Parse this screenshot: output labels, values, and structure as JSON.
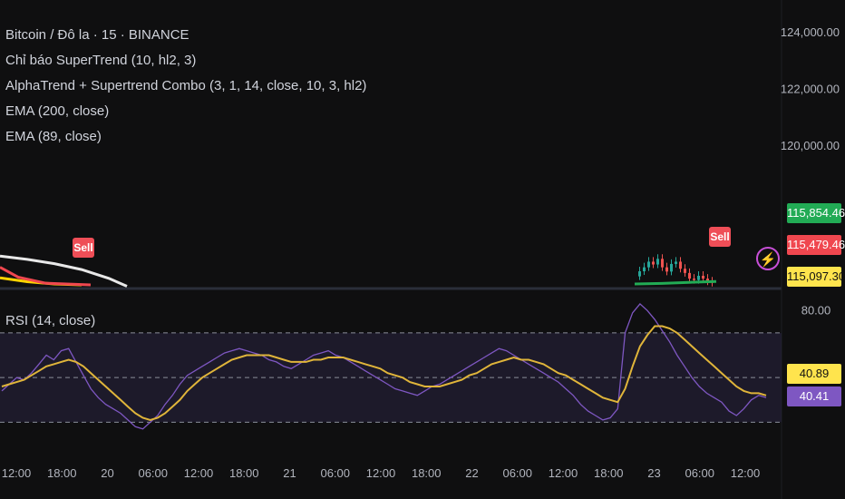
{
  "legend": {
    "symbol": "Bitcoin / Đô la · 15 · BINANCE",
    "supertrend": "Chỉ báo SuperTrend (10, hl2, 3)",
    "combo": "AlphaTrend + Supertrend Combo (3, 1, 14, close, 10, 3, hl2)",
    "ema200": "EMA (200, close)",
    "ema89": "EMA (89, close)"
  },
  "rsi_title": "RSI (14, close)",
  "sell_label": "Sell",
  "price_badges": {
    "green": "115,854.46",
    "red": "115,479.46",
    "yellow": "115,097.30",
    "rsi_ma": "40.89",
    "rsi": "40.41"
  },
  "colors": {
    "background": "#0f0f10",
    "green_badge": "#22ab55",
    "red_badge": "#f0474f",
    "yellow_badge": "#ffe44d",
    "rsi_line": "#7e57c2",
    "rsi_ma_line": "#e0b53a",
    "rsi_band": "#2a2540"
  },
  "chart_data": [
    {
      "type": "line",
      "title": "Bitcoin / Đô la · 15 · BINANCE",
      "y_ticks": [
        "124,000.00",
        "122,000.00",
        "120,000.00"
      ],
      "ylim": [
        114950,
        124200
      ],
      "series": [
        {
          "name": "EMA (200, close)",
          "color": "#e8e8e8",
          "points": [
            [
              0,
              116100
            ],
            [
              30,
              115980
            ],
            [
              60,
              115830
            ],
            [
              90,
              115620
            ],
            [
              120,
              115310
            ],
            [
              140,
              115030
            ]
          ]
        },
        {
          "name": "EMA (89, close)",
          "color": "#ffd400",
          "points": [
            [
              0,
              115330
            ],
            [
              30,
              115190
            ],
            [
              60,
              115110
            ],
            [
              90,
              115080
            ]
          ]
        },
        {
          "name": "SuperTrend",
          "color": "#f0474f",
          "points": [
            [
              0,
              115700
            ],
            [
              20,
              115350
            ],
            [
              50,
              115140
            ],
            [
              100,
              115080
            ]
          ]
        },
        {
          "name": "AlphaTrend",
          "color": "#22ab55",
          "points": [
            [
              700,
              115110
            ],
            [
              730,
              115130
            ],
            [
              760,
              115170
            ],
            [
              790,
              115200
            ]
          ]
        }
      ]
    },
    {
      "type": "line",
      "title": "RSI (14, close)",
      "y_ticks": [
        "80.00"
      ],
      "ylim": [
        20,
        85
      ],
      "bands": [
        70,
        50,
        30
      ],
      "x_ticks": [
        "12:00",
        "18:00",
        "20",
        "06:00",
        "12:00",
        "18:00",
        "21",
        "06:00",
        "12:00",
        "18:00",
        "22",
        "06:00",
        "12:00",
        "18:00",
        "23",
        "06:00",
        "12:00"
      ],
      "series": [
        {
          "name": "RSI",
          "values": [
            44,
            47,
            50,
            49,
            52,
            56,
            60,
            58,
            62,
            63,
            57,
            51,
            45,
            41,
            38,
            36,
            34,
            31,
            28,
            27,
            30,
            33,
            38,
            42,
            47,
            51,
            53,
            55,
            57,
            59,
            61,
            62,
            63,
            62,
            61,
            60,
            58,
            57,
            55,
            54,
            56,
            58,
            60,
            61,
            62,
            60,
            59,
            57,
            55,
            53,
            51,
            49,
            47,
            45,
            44,
            43,
            42,
            44,
            46,
            47,
            49,
            51,
            53,
            55,
            57,
            59,
            61,
            63,
            62,
            60,
            58,
            56,
            54,
            52,
            50,
            48,
            45,
            42,
            38,
            35,
            33,
            31,
            32,
            36,
            70,
            79,
            83,
            80,
            76,
            71,
            66,
            60,
            55,
            50,
            46,
            43,
            41,
            39,
            35,
            33,
            36,
            40,
            42,
            41
          ]
        },
        {
          "name": "RSI MA",
          "values": [
            46,
            47,
            48,
            49,
            51,
            53,
            55,
            56,
            57,
            58,
            57,
            55,
            52,
            49,
            46,
            43,
            40,
            37,
            34,
            32,
            31,
            32,
            34,
            37,
            40,
            44,
            47,
            50,
            52,
            54,
            56,
            58,
            59,
            60,
            60,
            60,
            60,
            59,
            58,
            57,
            57,
            57,
            58,
            58,
            59,
            59,
            59,
            58,
            57,
            56,
            55,
            54,
            52,
            51,
            50,
            48,
            47,
            46,
            46,
            46,
            47,
            48,
            49,
            51,
            52,
            54,
            56,
            57,
            58,
            59,
            58,
            58,
            57,
            56,
            54,
            52,
            51,
            49,
            47,
            45,
            43,
            41,
            40,
            39,
            45,
            55,
            64,
            69,
            73,
            73,
            72,
            70,
            67,
            64,
            61,
            58,
            55,
            52,
            49,
            46,
            44,
            43,
            43,
            42
          ]
        }
      ]
    }
  ]
}
